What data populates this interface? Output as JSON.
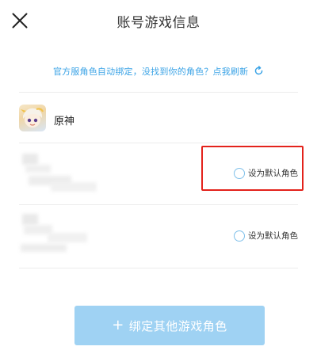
{
  "header": {
    "title": "账号游戏信息",
    "close_icon": "close-icon"
  },
  "notice": {
    "text": "官方服角色自动绑定，没找到你的角色？点我刷新",
    "icon": "refresh-icon",
    "color": "#3aa3e6"
  },
  "game": {
    "name": "原神",
    "icon": "game-avatar"
  },
  "roles": [
    {
      "default_label": "设为默认角色",
      "highlighted": true
    },
    {
      "default_label": "设为默认角色",
      "highlighted": false
    }
  ],
  "highlight_color": "#e3221b",
  "bind_button": {
    "icon": "+",
    "label": "绑定其他游戏角色",
    "color": "#9fd2f3"
  }
}
